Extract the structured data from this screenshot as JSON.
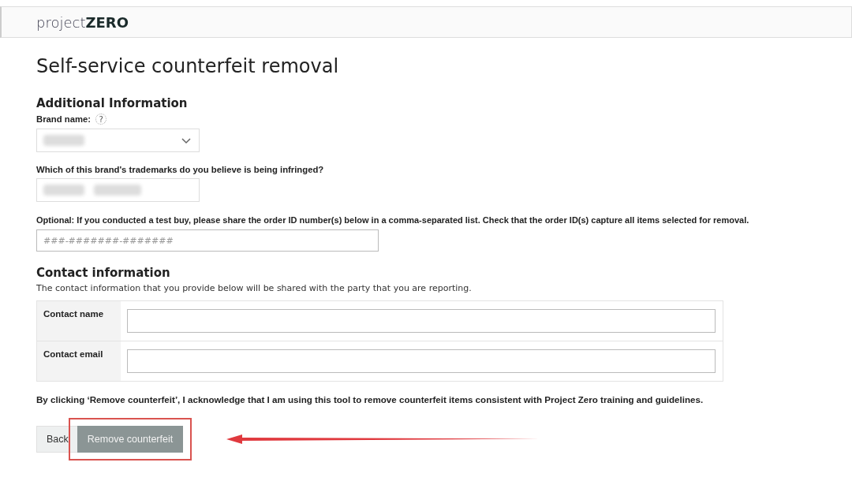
{
  "header": {
    "logo_light": "project",
    "logo_bold": "ZERO"
  },
  "title": "Self-service counterfeit removal",
  "additional": {
    "heading": "Additional Information",
    "brand": {
      "label": "Brand name:",
      "help": "?",
      "redacted": true
    },
    "trademark": {
      "label": "Which of this brand's trademarks do you believe is being infringed?",
      "redacted": true
    },
    "order": {
      "label": "Optional: If you conducted a test buy, please share the order ID number(s) below in a comma-separated list. Check that the order ID(s) capture all items selected for removal.",
      "placeholder": "###-#######-#######"
    }
  },
  "contact": {
    "heading": "Contact information",
    "description": "The contact information that you provide below will be shared with the party that you are reporting.",
    "rows": [
      {
        "label": "Contact name"
      },
      {
        "label": "Contact email"
      }
    ]
  },
  "acknowledgement": "By clicking ‘Remove counterfeit’, I acknowledge that I am using this tool to remove counterfeit items consistent with Project Zero training and guidelines.",
  "buttons": [
    {
      "label": "Back",
      "kind": "secondary",
      "disabled": false,
      "highlighted": false
    },
    {
      "label": "Remove counterfeit",
      "kind": "primary",
      "disabled": true,
      "highlighted": true
    }
  ]
}
